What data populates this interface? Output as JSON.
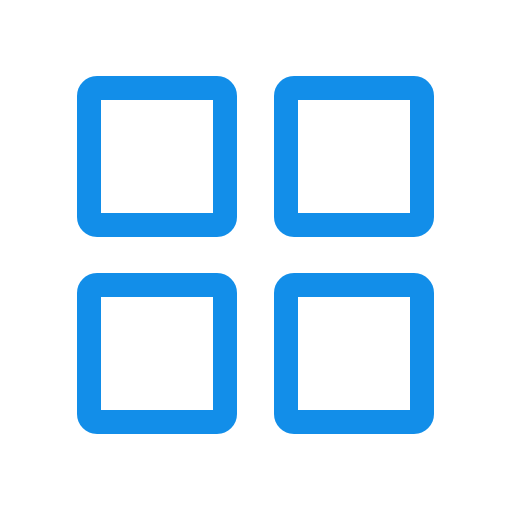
{
  "icon": {
    "name": "grid-view-icon",
    "tiles": [
      "top-left",
      "top-right",
      "bottom-left",
      "bottom-right"
    ]
  },
  "colors": {
    "accent": "#128ee9",
    "background": "#ffffff"
  }
}
